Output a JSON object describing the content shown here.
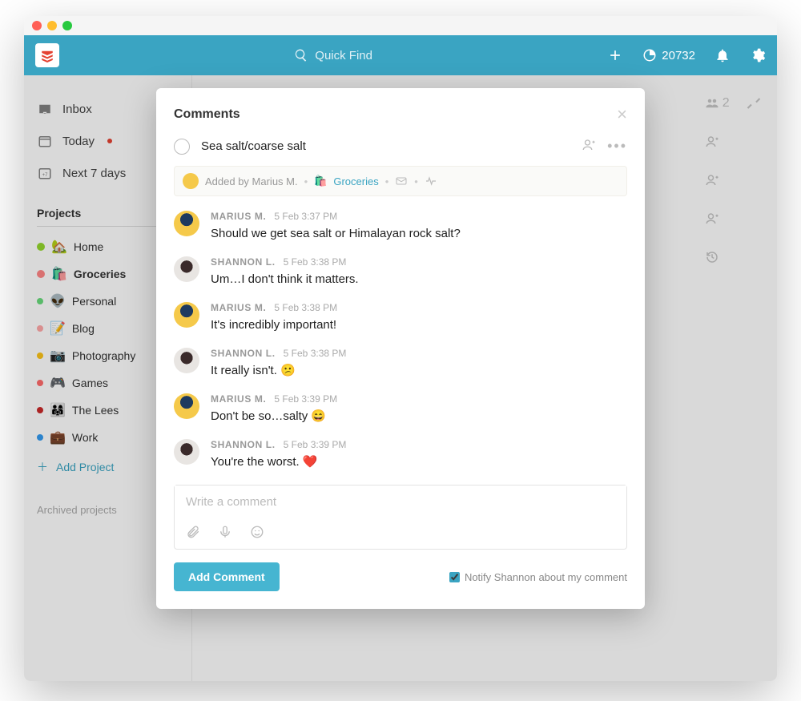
{
  "topbar": {
    "search_placeholder": "Quick Find",
    "karma": "20732"
  },
  "nav": {
    "inbox": "Inbox",
    "today": "Today",
    "next7": "Next 7 days"
  },
  "projects": {
    "title": "Projects",
    "items": [
      {
        "dot": "#94d82d",
        "emoji": "🏡",
        "label": "Home",
        "active": false,
        "icon": "person-green"
      },
      {
        "dot": "#ff8787",
        "emoji": "🛍️",
        "label": "Groceries",
        "active": true,
        "icon": "person-red"
      },
      {
        "dot": "#69db7c",
        "emoji": "👽",
        "label": "Personal",
        "active": false
      },
      {
        "dot": "#ffa8a8",
        "emoji": "📝",
        "label": "Blog",
        "active": false
      },
      {
        "dot": "#fcc419",
        "emoji": "📷",
        "label": "Photography",
        "active": false
      },
      {
        "dot": "#ff6b6b",
        "emoji": "🎮",
        "label": "Games",
        "active": false
      },
      {
        "dot": "#c92a2a",
        "emoji": "👨‍👩‍👧",
        "label": "The Lees",
        "active": false
      },
      {
        "dot": "#339af0",
        "emoji": "💼",
        "label": "Work",
        "active": false
      }
    ],
    "add": "Add Project",
    "archived": "Archived projects"
  },
  "background_right": {
    "people_count": "2"
  },
  "modal": {
    "title": "Comments",
    "task_name": "Sea salt/coarse salt",
    "meta": {
      "added_by": "Added by Marius M.",
      "project_emoji": "🛍️",
      "project": "Groceries"
    },
    "comments": [
      {
        "author": "MARIUS M.",
        "time": "5 Feb 3:37 PM",
        "text": "Should we get sea salt or Himalayan rock salt?",
        "avatar": "m"
      },
      {
        "author": "SHANNON L.",
        "time": "5 Feb 3:38 PM",
        "text": "Um…I don't think it matters.",
        "avatar": "s"
      },
      {
        "author": "MARIUS M.",
        "time": "5 Feb 3:38 PM",
        "text": "It's incredibly important!",
        "avatar": "m"
      },
      {
        "author": "SHANNON L.",
        "time": "5 Feb 3:38 PM",
        "text": "It really isn't. 😕",
        "avatar": "s"
      },
      {
        "author": "MARIUS M.",
        "time": "5 Feb 3:39 PM",
        "text": "Don't be so…salty 😄",
        "avatar": "m"
      },
      {
        "author": "SHANNON L.",
        "time": "5 Feb 3:39 PM",
        "text": "You're the worst. ❤️",
        "avatar": "s"
      }
    ],
    "composer_placeholder": "Write a comment",
    "add_button": "Add Comment",
    "notify_label": "Notify Shannon about my comment"
  }
}
